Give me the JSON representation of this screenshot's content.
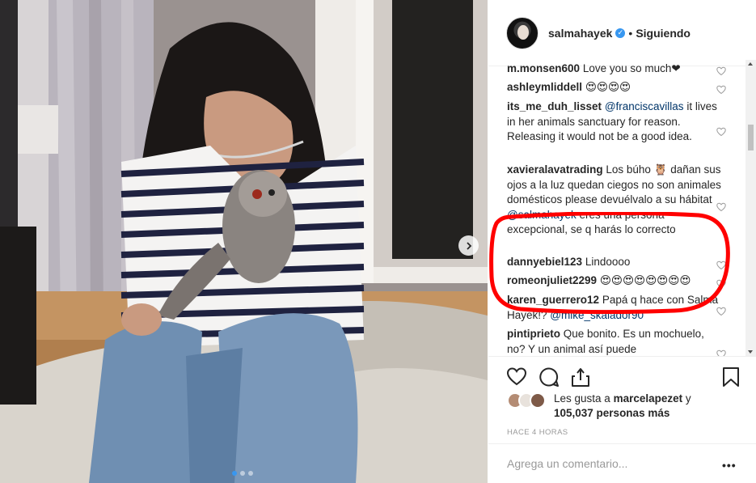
{
  "post": {
    "username": "salmahayek",
    "separator": "•",
    "follow_label": "Siguiendo",
    "verified_mark": "✓"
  },
  "comments": [
    {
      "user": "m.monsen600",
      "parts": [
        {
          "t": "text",
          "v": "Love you so much❤"
        }
      ]
    },
    {
      "user": "ashleymliddell",
      "parts": [
        {
          "t": "text",
          "v": "😍😍😍😍"
        }
      ]
    },
    {
      "user": "its_me_duh_lisset",
      "parts": [
        {
          "t": "mention",
          "v": "@franciscavillas"
        },
        {
          "t": "text",
          "v": " it lives in her animals sanctuary for reason. Releasing it would not be a good idea."
        }
      ]
    },
    {
      "user": "xavieralavatrading",
      "parts": [
        {
          "t": "text",
          "v": "Los búho 🦉 dañan sus ojos a la luz quedan ciegos no son animales domésticos please devuélvalo a su hábitat "
        },
        {
          "t": "mention",
          "v": "@salmahayek"
        },
        {
          "t": "text",
          "v": " eres una persona excepcional, se q harás lo correcto"
        }
      ]
    },
    {
      "user": "dannyebiel123",
      "parts": [
        {
          "t": "text",
          "v": "Lindoooo"
        }
      ]
    },
    {
      "user": "romeonjuliet2299",
      "parts": [
        {
          "t": "text",
          "v": "😍😍😍😍😍😍😍😍"
        }
      ]
    },
    {
      "user": "karen_guerrero12",
      "parts": [
        {
          "t": "text",
          "v": "Papá q hace con Salma Hayek!? "
        },
        {
          "t": "mention",
          "v": "@mike_skalador90"
        }
      ]
    },
    {
      "user": "pintiprieto",
      "parts": [
        {
          "t": "text",
          "v": "Que bonito. Es un mochuelo, no? Y un animal así puede"
        }
      ]
    }
  ],
  "likes": {
    "prefix": "Les gusta a ",
    "user": "marcelapezet",
    "middle": " y ",
    "count": "105,037 personas más"
  },
  "timestamp": "Hace 4 horas",
  "add_comment_placeholder": "Agrega un comentario...",
  "more_label": "•••",
  "colors": {
    "accent": "#3897f0",
    "highlight": "#ff0000",
    "mention": "#003569"
  },
  "icons": [
    "heart-icon",
    "comment-icon",
    "share-icon",
    "bookmark-icon",
    "chevron-right-icon",
    "verified-icon"
  ]
}
